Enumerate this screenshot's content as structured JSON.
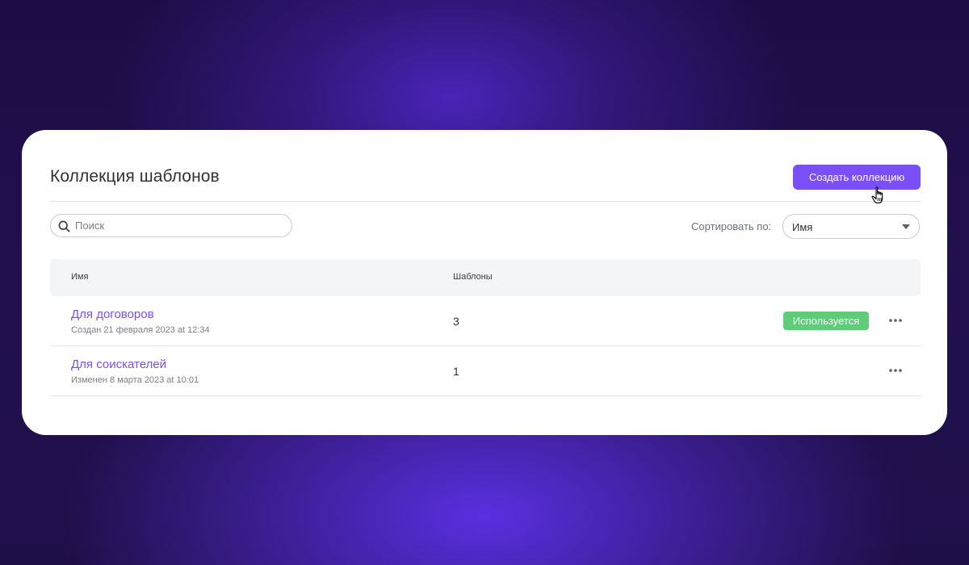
{
  "header": {
    "title": "Коллекция шаблонов",
    "create_button_label": "Создать коллекцию"
  },
  "search": {
    "placeholder": "Поиск",
    "value": ""
  },
  "sort": {
    "label": "Сортировать по:",
    "selected": "Имя"
  },
  "table": {
    "columns": [
      "Имя",
      "Шаблоны"
    ],
    "rows": [
      {
        "name": "Для договоров",
        "meta": "Создан 21 февраля 2023 at 12:34",
        "count": "3",
        "status": "Используется"
      },
      {
        "name": "Для соискателей",
        "meta": "Изменен 8 марта 2023 at 10:01",
        "count": "1",
        "status": ""
      }
    ]
  },
  "colors": {
    "accent": "#7b4ff7",
    "status_green": "#5fcc7a",
    "background": "#1f0f49"
  },
  "icons": {
    "search": "search-icon",
    "dropdown": "chevron-down-icon",
    "row_menu": "more-horizontal-icon",
    "pointer": "hand-pointer-icon"
  }
}
